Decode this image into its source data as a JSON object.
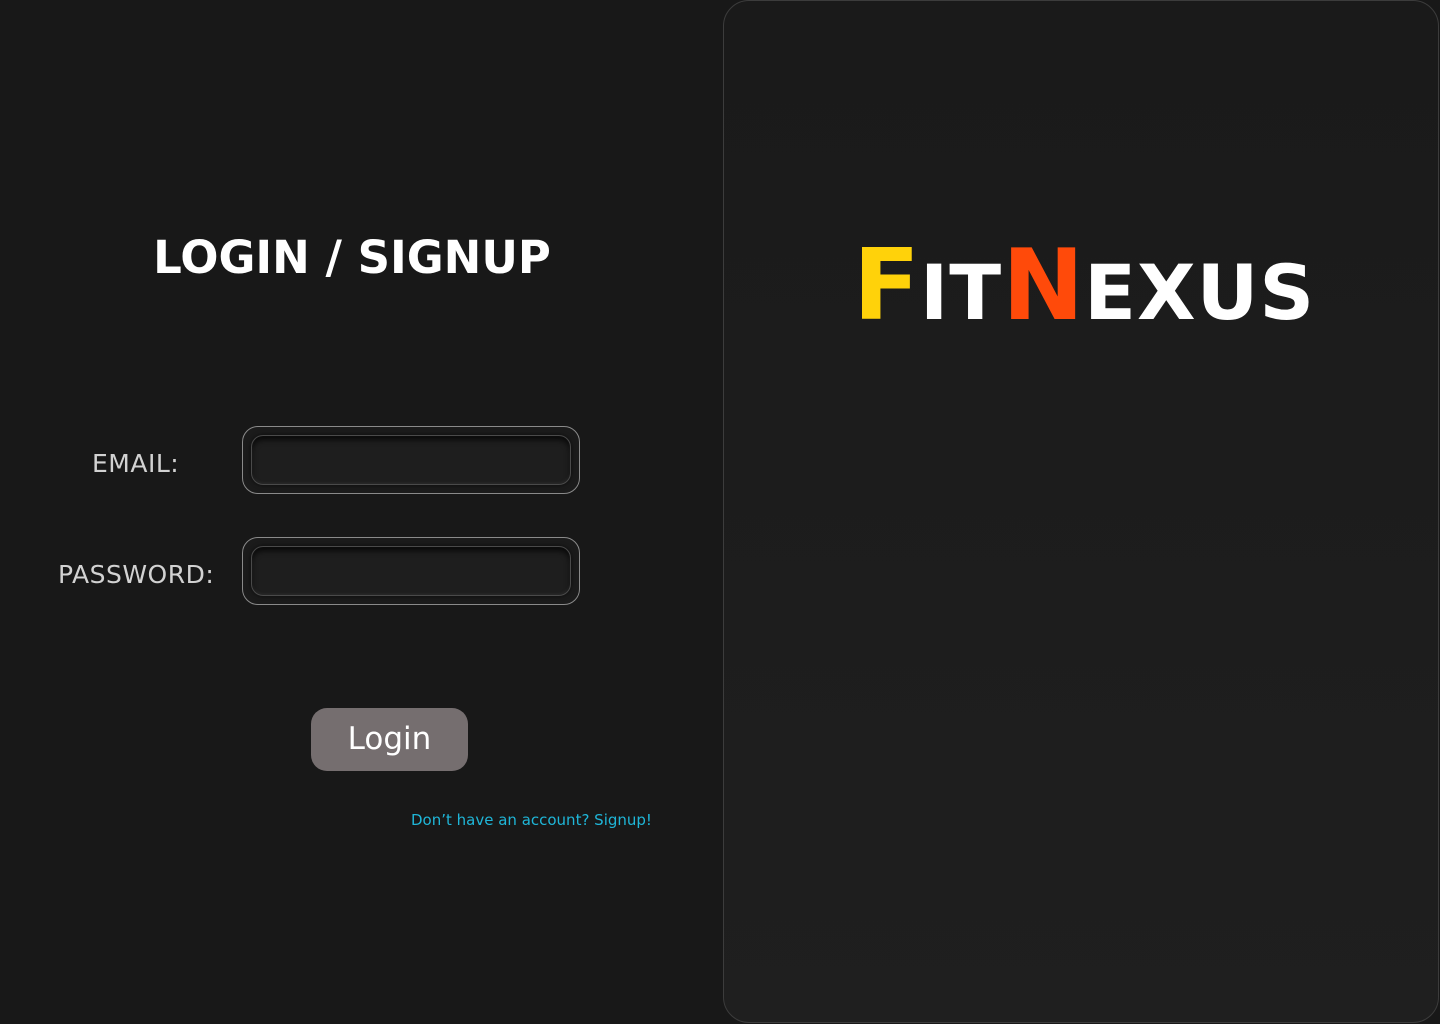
{
  "login": {
    "heading": "LOGIN / SIGNUP",
    "email_label": "EMAIL:",
    "email_value": "",
    "password_label": "PASSWORD:",
    "password_value": "",
    "login_button": "Login",
    "signup_link": "Don’t have an account? Signup!"
  },
  "brand": {
    "part1_initial": "F",
    "part1_rest": "IT",
    "part2_initial": "N",
    "part2_rest": "EXUS",
    "colors": {
      "f_initial": "#FFD20A",
      "n_initial": "#FF4A0A",
      "rest": "#FFFFFF"
    }
  },
  "theme": {
    "background": "#181818",
    "button_bg": "#756E6F",
    "link_color": "#1FB6D8"
  }
}
